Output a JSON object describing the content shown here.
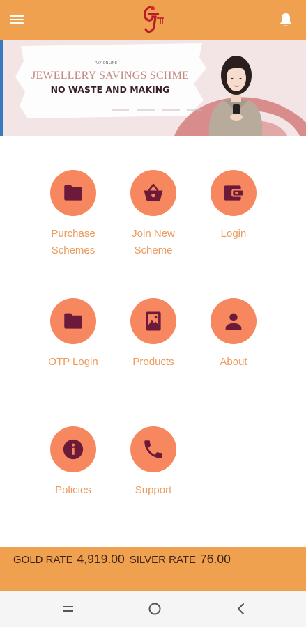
{
  "header": {
    "menu_icon": "hamburger-menu-icon",
    "logo_icon": "brand-logo-icon",
    "notification_icon": "bell-icon",
    "bar_color": "#f0a150"
  },
  "banner": {
    "kicker": "PAY ONLINE",
    "title": "JEWELLERY SAVINGS SCHME",
    "subtitle": "NO WASTE AND MAKING"
  },
  "menu": {
    "circle_color": "#f7875f",
    "icon_color": "#6b1a3a",
    "label_color": "#ee9a5d",
    "items": [
      {
        "label": "Purchase Schemes",
        "icon": "folder-icon"
      },
      {
        "label": "Join New Scheme",
        "icon": "basket-icon"
      },
      {
        "label": "Login",
        "icon": "wallet-icon"
      },
      {
        "label": "OTP Login",
        "icon": "folder-icon"
      },
      {
        "label": "Products",
        "icon": "image-book-icon"
      },
      {
        "label": "About",
        "icon": "person-icon"
      },
      {
        "label": "Policies",
        "icon": "info-icon"
      },
      {
        "label": "Support",
        "icon": "phone-icon"
      }
    ]
  },
  "rates": {
    "gold_label": "GOLD RATE",
    "gold_value": "4,919.00",
    "silver_label": "SILVER RATE",
    "silver_value": "76.00"
  },
  "system_nav": {
    "recents_icon": "recents-icon",
    "home_icon": "home-circle-icon",
    "back_icon": "back-chevron-icon"
  }
}
